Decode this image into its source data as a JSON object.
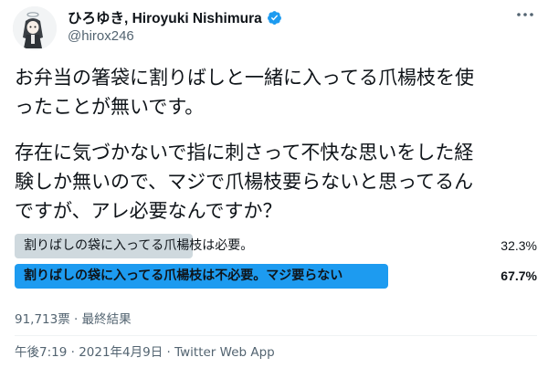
{
  "author": {
    "display_name": "ひろゆき, Hiroyuki Nishimura",
    "handle": "@hirox246",
    "verified": true,
    "avatar_icon": "avatar-illustration-icon",
    "more_icon": "more-options-icon"
  },
  "tweet": {
    "paragraph1": "お弁当の箸袋に割りばしと一緒に入ってる爪楊枝を使\nったことが無いです。",
    "paragraph2": "存在に気づかないで指に刺さって不快な思いをした経\n験しか無いので、マジで爪楊枝要らないと思ってるん\nですが、アレ必要なんですか？"
  },
  "poll": {
    "options": [
      {
        "label": "割りばしの袋に入ってる爪楊枝は必要。",
        "percent_text": "32.3%",
        "percent": 32.3,
        "winner": false
      },
      {
        "label": "割りばしの袋に入ってる爪楊枝は不必要。マジ要らない",
        "percent_text": "67.7%",
        "percent": 67.7,
        "winner": true
      }
    ],
    "meta": "91,713票 · 最終結果",
    "colors": {
      "winner": "#1d9bf0",
      "loser": "#cfd9de"
    }
  },
  "timestamp": "午後7:19 · 2021年4月9日 · Twitter Web App",
  "colors": {
    "accent": "#1d9bf0",
    "text": "#0f1419",
    "secondary": "#536471"
  }
}
